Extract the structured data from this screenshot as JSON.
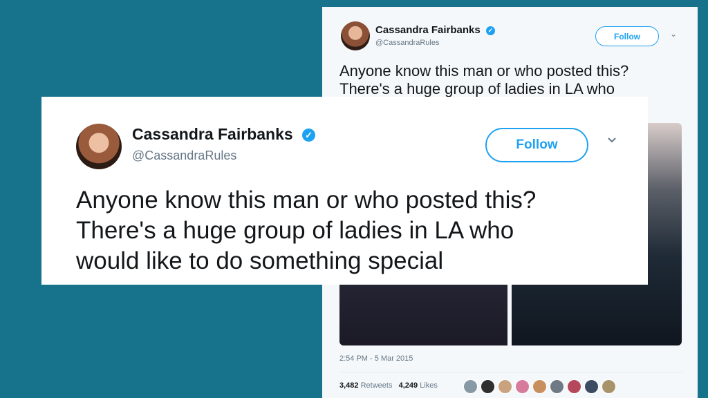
{
  "tweet": {
    "display_name": "Cassandra Fairbanks",
    "handle": "@CassandraRules",
    "follow_label": "Follow",
    "verified_glyph": "✓",
    "chevron_glyph": "⌄",
    "text_line1": "Anyone know this man or who posted this?",
    "text_line2": "There's a huge group of ladies in LA who",
    "text_line3": "would like to do something special",
    "timestamp": "2:54 PM - 5 Mar 2015",
    "retweets_count": "3,482",
    "retweets_label": "Retweets",
    "likes_count": "4,249",
    "likes_label": "Likes"
  },
  "colors": {
    "background": "#17738c",
    "accent": "#1da1f2",
    "text": "#14171a",
    "muted": "#657786"
  },
  "icons": {
    "verified": "verified-badge-icon",
    "menu": "chevron-down-icon"
  }
}
